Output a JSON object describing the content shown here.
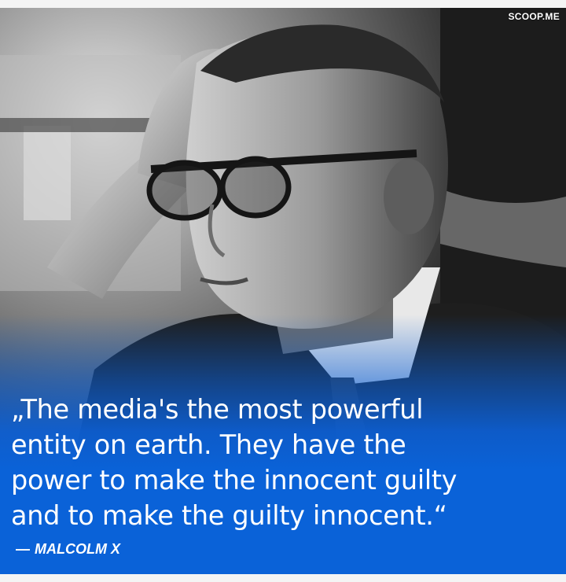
{
  "brand": {
    "label": "SCOOP.ME"
  },
  "photo": {
    "subject": "portrait-photo"
  },
  "quote": {
    "lines": [
      "„The media's the most powerful",
      "entity on earth. They have the",
      "power to make the innocent guilty",
      "and to make the guilty innocent.“"
    ],
    "dash": "—",
    "author": "MALCOLM X"
  },
  "colors": {
    "accent": "#0a62d8",
    "text": "#ffffff"
  }
}
